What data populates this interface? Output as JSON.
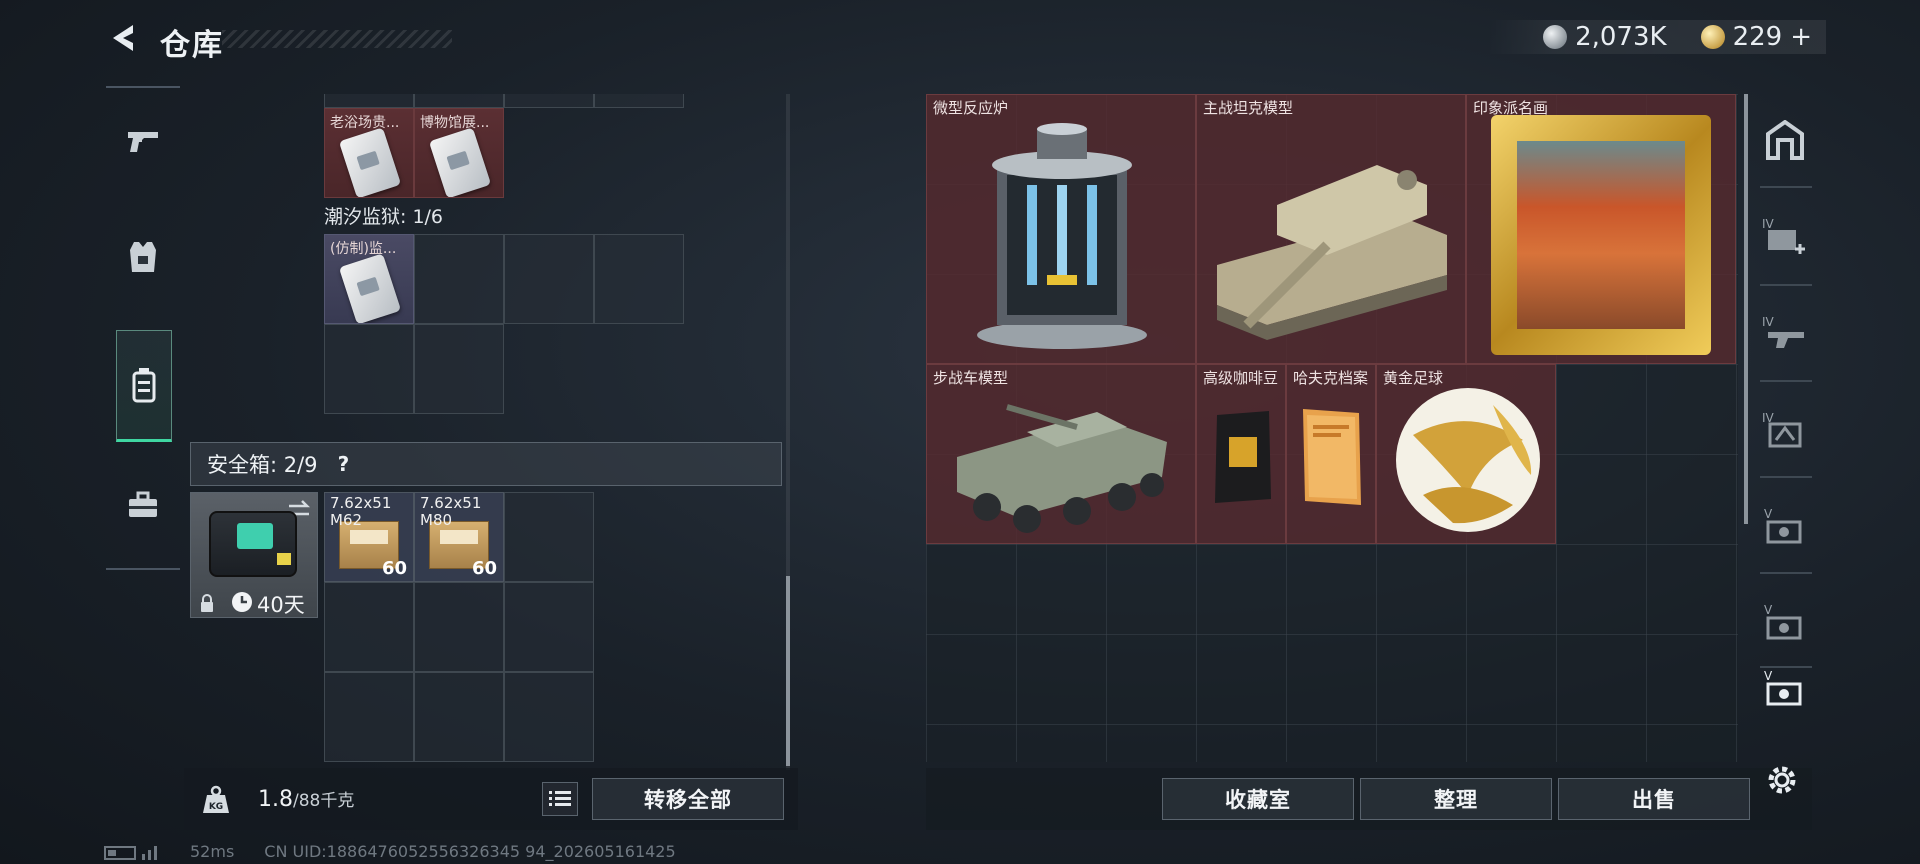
{
  "header": {
    "title": "仓库",
    "currency": [
      {
        "icon": "silver-coin-icon",
        "value": "2,073K"
      },
      {
        "icon": "gold-triangle-coin-icon",
        "value": "229"
      }
    ],
    "add_symbol": "+"
  },
  "left_nav": {
    "items": [
      {
        "icon": "pistol-icon"
      },
      {
        "icon": "armor-vest-icon"
      },
      {
        "icon": "backpack-icon",
        "active": true
      },
      {
        "icon": "briefcase-icon"
      }
    ]
  },
  "left_panel": {
    "top_items": [
      {
        "label": "老浴场贵..."
      },
      {
        "label": "博物馆展..."
      }
    ],
    "section_tidal_prison": "潮汐监狱: 1/6",
    "tidal_item": {
      "label": "(仿制)监..."
    },
    "safebox": {
      "label": "安全箱: 2/9",
      "help": "?",
      "timer": "40天",
      "ammo": [
        {
          "caliber": "7.62x51",
          "type": "M62",
          "count": "60"
        },
        {
          "caliber": "7.62x51",
          "type": "M80",
          "count": "60"
        }
      ]
    },
    "weight_value": "1.8",
    "weight_max": "/88千克",
    "weight_icon_label": "KG",
    "transfer_all_label": "转移全部"
  },
  "right_panel": {
    "items": [
      {
        "label": "微型反应炉"
      },
      {
        "label": "主战坦克模型"
      },
      {
        "label": "印象派名画"
      },
      {
        "label": "步战车模型"
      },
      {
        "label": "高级咖啡豆"
      },
      {
        "label": "哈夫克档案"
      },
      {
        "label": "黄金足球"
      }
    ],
    "buttons": {
      "collection": "收藏室",
      "organize": "整理",
      "sell": "出售"
    }
  },
  "right_rail": {
    "tabs": [
      {
        "icon": "vault-icon"
      },
      {
        "icon": "tier-iv-add-icon",
        "tier": "IV"
      },
      {
        "icon": "tier-iv-gun-icon",
        "tier": "IV"
      },
      {
        "icon": "tier-iv-bag-icon",
        "tier": "IV"
      },
      {
        "icon": "tier-v-box-icon",
        "tier": "V"
      },
      {
        "icon": "tier-v-box-icon",
        "tier": "V"
      },
      {
        "icon": "tier-v-box-icon",
        "tier": "V"
      }
    ],
    "settings_icon": "gear-icon"
  },
  "status": {
    "ping": "52ms",
    "uid": "CN UID:1886476052556326345 94_202605161425"
  }
}
